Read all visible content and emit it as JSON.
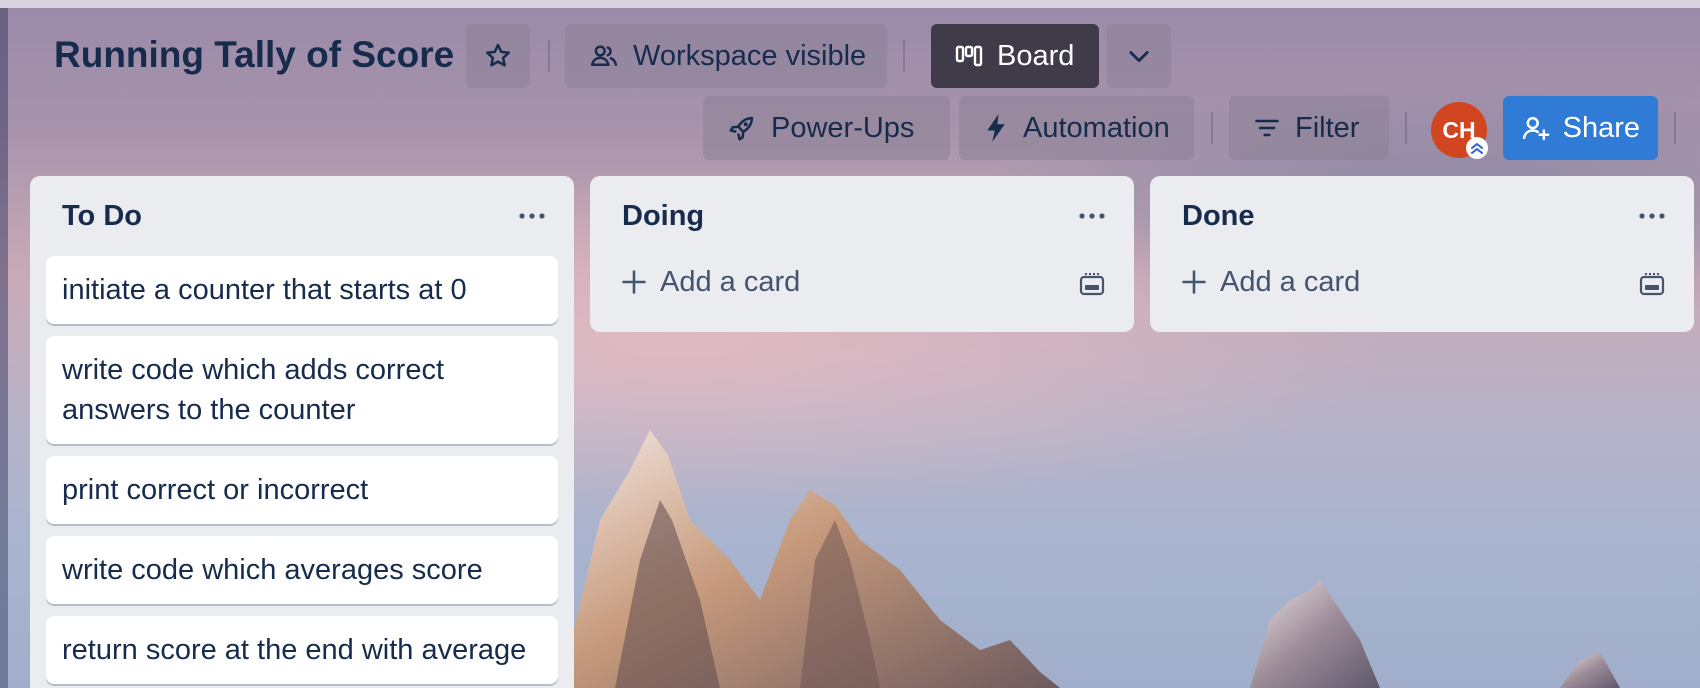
{
  "board": {
    "title": "Running Tally of Score",
    "visibility_label": "Workspace visible",
    "view_label": "Board",
    "powerups_label": "Power-Ups",
    "automation_label": "Automation",
    "filter_label": "Filter",
    "member_initials": "CH",
    "share_label": "Share"
  },
  "lists": [
    {
      "title": "To Do",
      "cards": [
        "initiate a counter that starts at 0",
        "write code which adds correct answers to the counter",
        "print correct or incorrect",
        "write code which averages score",
        "return score at the end with average"
      ]
    },
    {
      "title": "Doing",
      "add_card_label": "Add a card"
    },
    {
      "title": "Done",
      "add_card_label": "Add a card"
    }
  ],
  "colors": {
    "board_button_bg": "#3f3b48",
    "share_button_bg": "#2f7bd6",
    "avatar_bg": "#d24521",
    "list_bg": "#ebecf0",
    "text": "#172b4d"
  }
}
